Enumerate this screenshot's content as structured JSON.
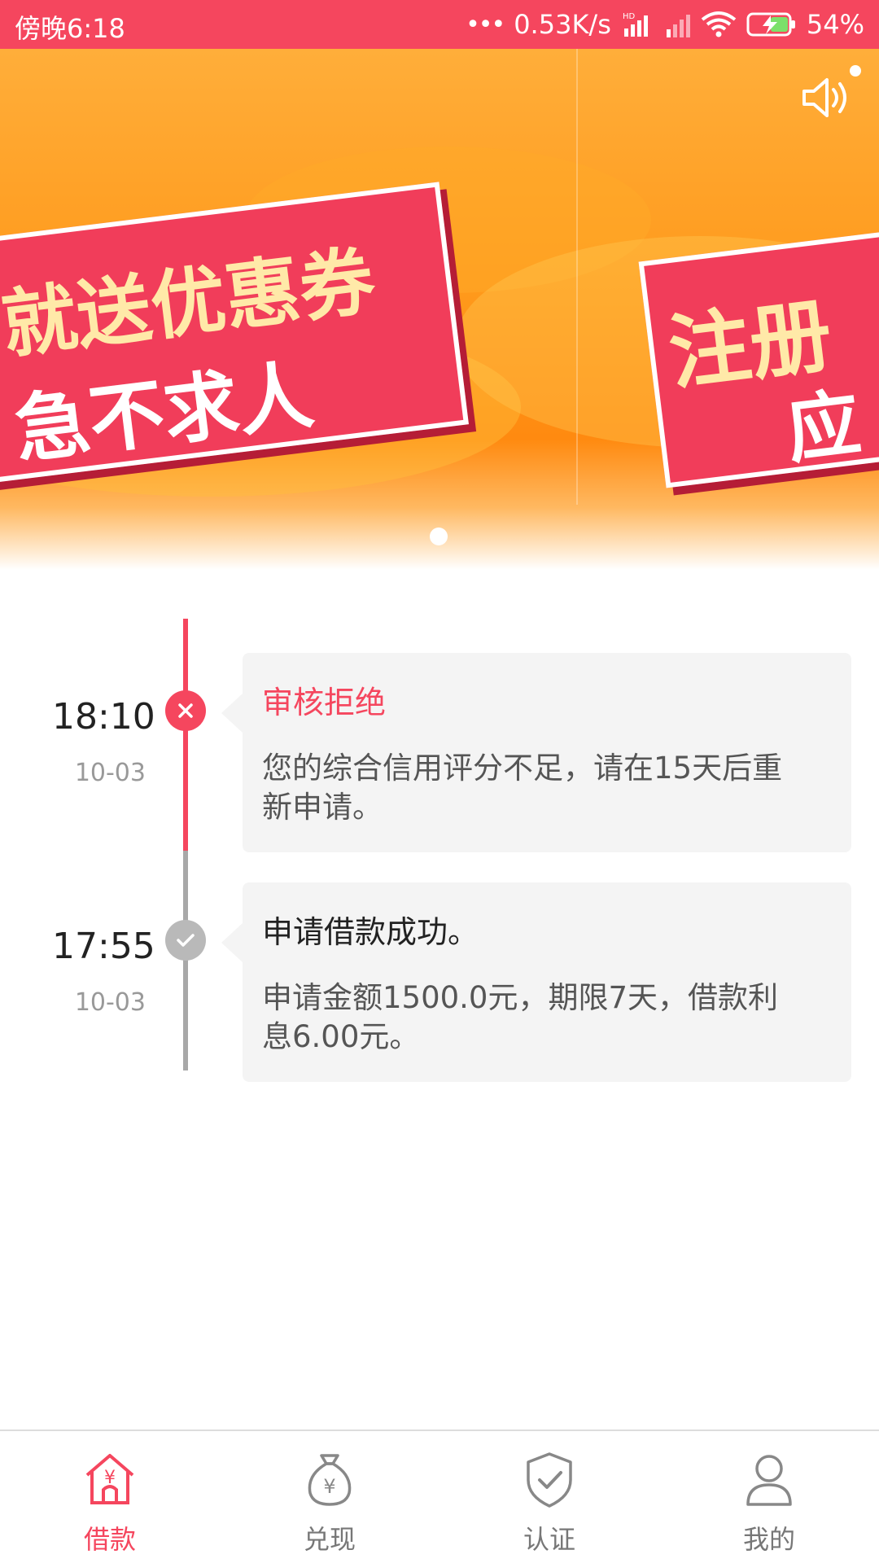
{
  "status_bar": {
    "time": "傍晚6:18",
    "dots": "•••",
    "net_speed": "0.53K/s",
    "network_tag": "HD",
    "battery": "54%",
    "colors": {
      "background": "#f5465e"
    },
    "icons": [
      "signal-icon",
      "wifi-icon",
      "battery-charging-icon"
    ]
  },
  "banner": {
    "slide1_line1": "就送优惠券",
    "slide1_line2": "急不求人",
    "slide2_line1": "注册",
    "slide2_line2": "应",
    "page_count": 1,
    "icons": [
      "sound-icon"
    ]
  },
  "timeline": {
    "entries": [
      {
        "time": "18:10",
        "date": "10-03",
        "status": "rejected",
        "title": "审核拒绝",
        "body": "您的综合信用评分不足，请在15天后重新申请。"
      },
      {
        "time": "17:55",
        "date": "10-03",
        "status": "success",
        "title": "申请借款成功。",
        "body": "申请金额1500.0元，期限7天，借款利息6.00元。"
      }
    ]
  },
  "bottom_nav": {
    "items": [
      {
        "label": "借款",
        "icon": "loan-house-yen-icon",
        "active": true
      },
      {
        "label": "兑现",
        "icon": "money-bag-yen-icon",
        "active": false
      },
      {
        "label": "认证",
        "icon": "shield-check-icon",
        "active": false
      },
      {
        "label": "我的",
        "icon": "user-profile-icon",
        "active": false
      }
    ]
  },
  "colors": {
    "accent": "#f5465e",
    "inactive": "#777777",
    "card_bg": "#f4f4f4"
  }
}
